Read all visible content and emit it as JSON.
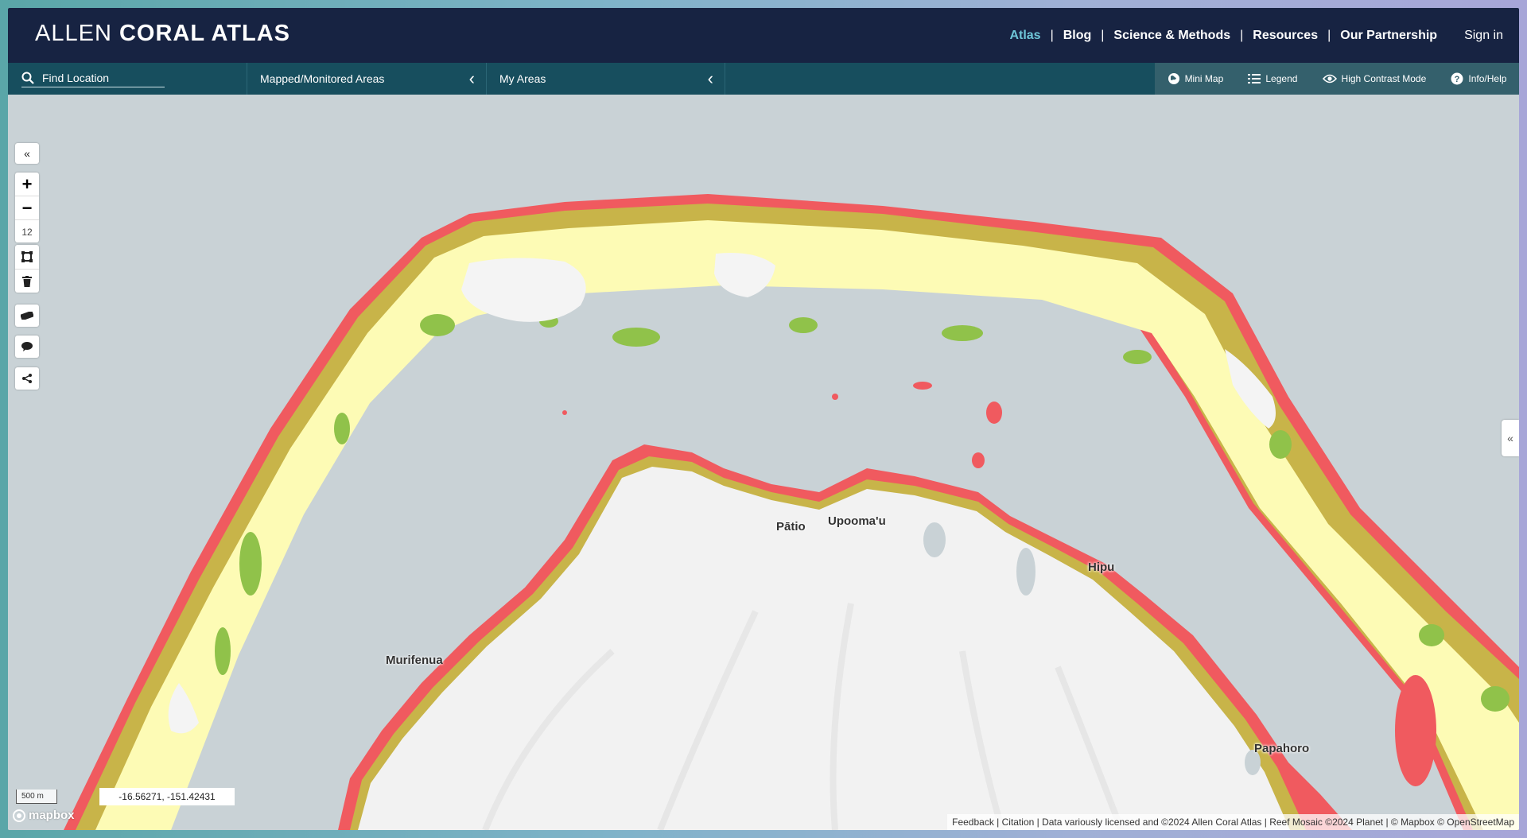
{
  "header": {
    "logo_part1": "ALLEN",
    "logo_part2": "CORAL ATLAS",
    "nav": [
      "Atlas",
      "Blog",
      "Science & Methods",
      "Resources",
      "Our Partnership"
    ],
    "separator": "|",
    "sign_in": "Sign in",
    "active_color": "#6ec6d8"
  },
  "toolbar": {
    "search_label": "Find Location",
    "tabs": [
      "Mapped/Monitored Areas",
      "My Areas"
    ],
    "tools": [
      "Mini Map",
      "Legend",
      "High Contrast Mode",
      "Info/Help"
    ]
  },
  "map": {
    "zoom_level": "12",
    "collapse_symbol": "«",
    "places": [
      "Pātio",
      "Upooma'u",
      "Hipu",
      "Murifenua",
      "Papahoro"
    ],
    "scale_label": "500 m",
    "coordinates": "-16.56271, -151.42431",
    "mapbox_label": "mapbox",
    "attribution": "Feedback | Citation | Data variously licensed and ©2024 Allen Coral Atlas | Reef Mosaic ©2024 Planet | © Mapbox © OpenStreetMap",
    "colors": {
      "water": "#c9d2d6",
      "land": "#f2f2f2",
      "reef_crest": "#f05a5f",
      "reef_flat": "#c8b449",
      "sand": "#fdfbb5",
      "seagrass": "#90c24a",
      "coral_algae": "#f5a8a0"
    }
  }
}
